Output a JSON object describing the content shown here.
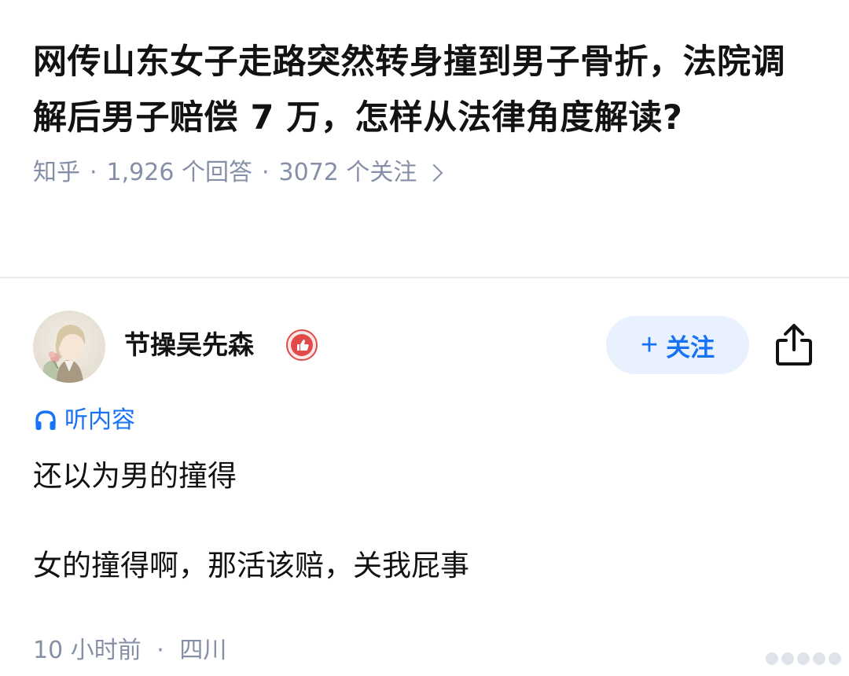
{
  "question": {
    "title": "网传山东女子走路突然转身撞到男子骨折，法院调解后男子赔偿 7 万，怎样从法律角度解读?",
    "source": "知乎",
    "separator": "·",
    "answer_count": "1,926 个回答",
    "follower_count": "3072 个关注"
  },
  "author": {
    "name": "节操吴先森",
    "avatar_icon": "avatar-illustration",
    "badge_icon": "thumbs-up-badge-icon",
    "follow_label": "关注",
    "follow_plus": "+",
    "share_icon": "share-icon"
  },
  "listen": {
    "icon": "headphones-icon",
    "label": "听内容"
  },
  "answer": {
    "paragraphs": [
      "还以为男的撞得",
      "女的撞得啊，那活该赔，关我屁事"
    ]
  },
  "footer": {
    "time": "10 小时前",
    "separator": "·",
    "location": "四川"
  },
  "colors": {
    "accent": "#1772f6",
    "follow_bg": "#e8f1fd",
    "meta": "#8590a6",
    "text": "#121212",
    "badge_red": "#e24a4a"
  }
}
